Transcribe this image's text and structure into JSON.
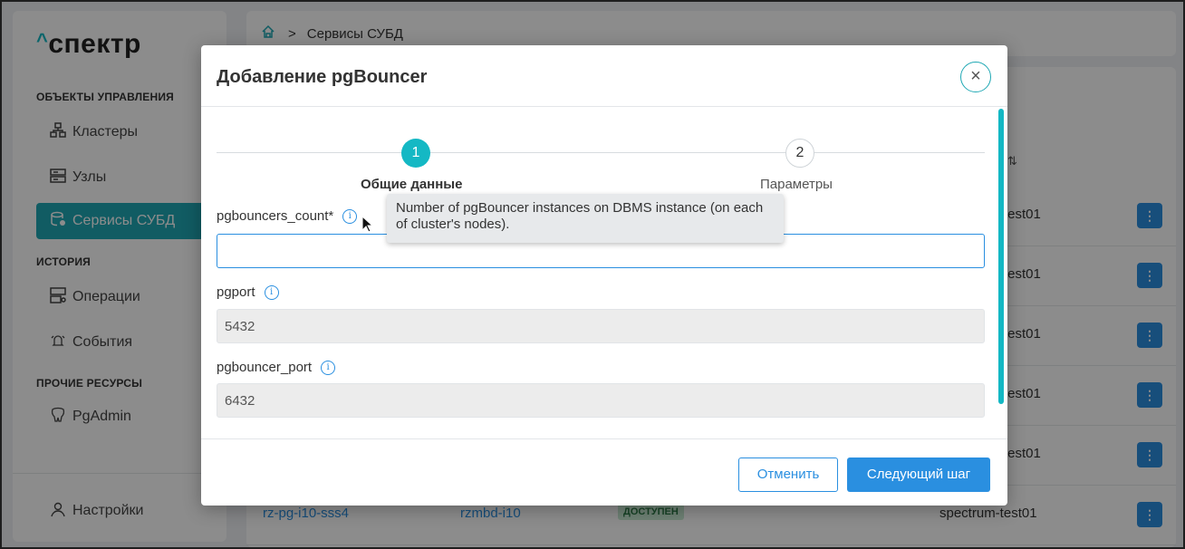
{
  "app": {
    "logo_caret": "^",
    "logo_text": "спектр"
  },
  "sidebar": {
    "section_management": "ОБЪЕКТЫ УПРАВЛЕНИЯ",
    "section_history": "ИСТОРИЯ",
    "section_other": "ПРОЧИЕ РЕСУРСЫ",
    "items": [
      {
        "label": "Кластеры",
        "icon": "cluster-icon"
      },
      {
        "label": "Узлы",
        "icon": "server-icon"
      },
      {
        "label": "Сервисы СУБД",
        "icon": "database-icon",
        "active": true
      },
      {
        "label": "Операции",
        "icon": "operations-icon"
      },
      {
        "label": "События",
        "icon": "bell-icon"
      },
      {
        "label": "PgAdmin",
        "icon": "elephant-icon"
      }
    ],
    "settings_label": "Настройки"
  },
  "breadcrumb": {
    "home_icon": "home-icon",
    "separator": ">",
    "current": "Сервисы СУБД"
  },
  "table": {
    "sort_icon": "⇅",
    "rows": [
      {
        "cluster": "test01"
      },
      {
        "cluster": "test01"
      },
      {
        "cluster": "test01"
      },
      {
        "cluster": "test01"
      },
      {
        "cluster": "test01"
      },
      {
        "service": "rz-pg-i10-sss4",
        "node": "rzmbd-i10",
        "status": "ДОСТУПЕН",
        "cluster": "spectrum-test01"
      }
    ],
    "action_glyph": "⋮"
  },
  "modal": {
    "title": "Добавление pgBouncer",
    "close_glyph": "×",
    "steps": [
      {
        "number": "1",
        "label": "Общие данные",
        "active": true
      },
      {
        "number": "2",
        "label": "Параметры",
        "active": false
      }
    ],
    "fields": {
      "pgbouncers_count": {
        "label": "pgbouncers_count*",
        "value": ""
      },
      "pgport": {
        "label": "pgport",
        "value": "5432"
      },
      "pgbouncer_port": {
        "label": "pgbouncer_port",
        "value": "6432"
      }
    },
    "info_glyph": "i",
    "tooltip": "Number of pgBouncer instances on DBMS instance (on each of cluster's nodes).",
    "cancel_label": "Отменить",
    "next_label": "Следующий шаг"
  },
  "colors": {
    "accent": "#14b8c4",
    "primary": "#2a8fe0",
    "active_nav": "#1fa8b4"
  }
}
